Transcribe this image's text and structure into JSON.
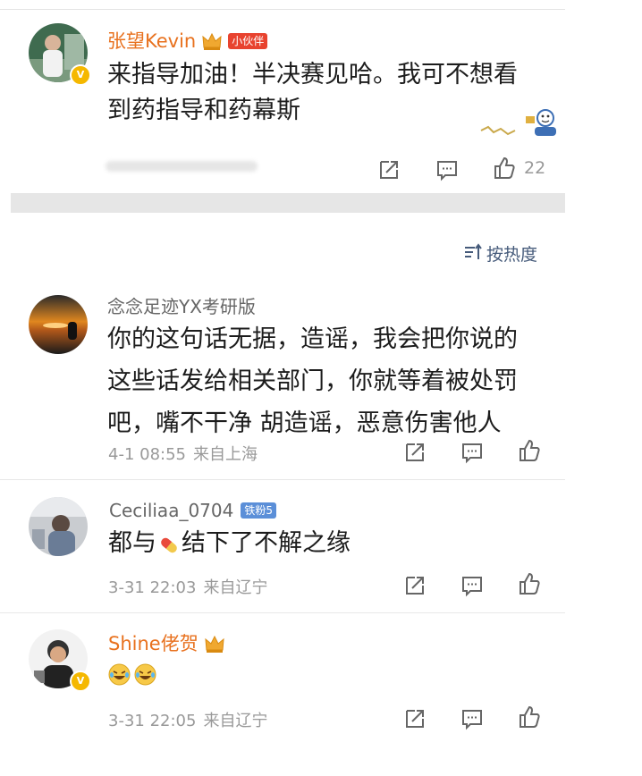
{
  "post": {
    "username": "张望Kevin",
    "badge": "小伙伴",
    "text_lines": [
      "来指导加油！半决赛见哈。我可不想看",
      "到药指导和药幕斯"
    ],
    "like_count": "22"
  },
  "sort": {
    "label": "按热度"
  },
  "comments": [
    {
      "username": "念念足迹YX考研版",
      "text_lines": [
        "你的这句话无据，造谣，我会把你说的",
        "这些话发给相关部门，你就等着被处罚",
        "吧，嘴不干净 胡造谣，恶意伤害他人"
      ],
      "time": "4-1 08:55",
      "from": "来自上海"
    },
    {
      "username": "Ceciliaa_0704",
      "badge": "铁粉5",
      "text_before": "都与",
      "text_after": "结下了不解之缘",
      "time": "3-31 22:03",
      "from": "来自辽宁"
    },
    {
      "username": "Shine佬贺",
      "time": "3-31 22:05",
      "from": "来自辽宁"
    }
  ],
  "colors": {
    "accent_orange": "#e8711e",
    "badge_red": "#e8432f",
    "badge_blue": "#5b8fd8",
    "verified_gold": "#f5b800",
    "meta_gray": "#999999"
  },
  "icons": [
    "share-icon",
    "comment-icon",
    "like-icon",
    "crown-icon",
    "pill-icon",
    "laugh-cry-emoji",
    "sort-icon"
  ]
}
